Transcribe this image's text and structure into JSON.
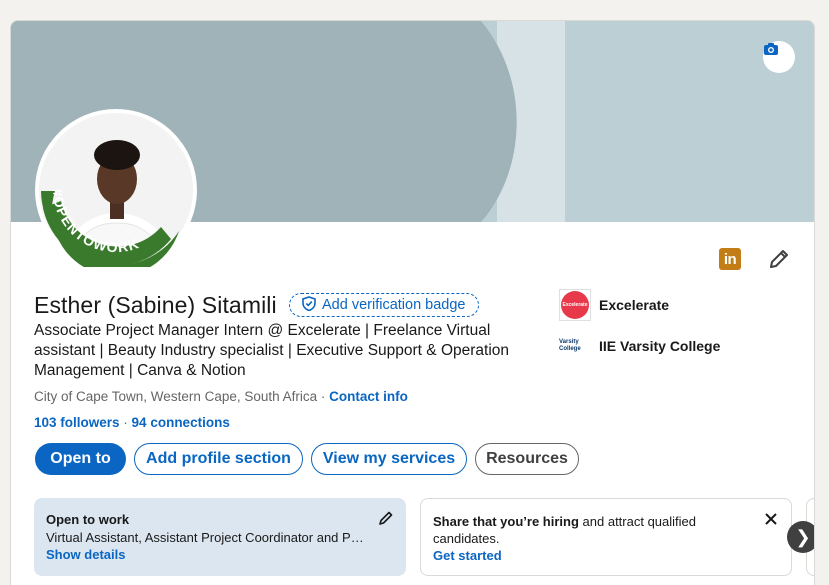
{
  "banner": {
    "camera_icon": "camera-icon",
    "colors": {
      "bg": "#bccfd4",
      "arc": "#9fb3b9",
      "stripe": "#d6e2e5"
    }
  },
  "profile": {
    "name": "Esther (Sabine) Sitamili",
    "verify_label": "Add verification badge",
    "headline": "Associate Project Manager Intern @ Excelerate | Freelance Virtual assistant | Beauty Industry specialist | Executive Support & Operation Management | Canva & Notion",
    "location": "City of Cape Town, Western Cape, South Africa",
    "location_sep": " · ",
    "contact_label": "Contact info",
    "followers": "103 followers",
    "network_sep": " · ",
    "connections": "94 connections",
    "open_to_work_frame": "#OPENTOWORK"
  },
  "orgs": [
    {
      "name": "Excelerate",
      "logo_text": "Excelerate"
    },
    {
      "name": "IIE Varsity College",
      "logo_text_1": "Varsity",
      "logo_text_2": "College"
    }
  ],
  "actions": {
    "open_to": "Open to",
    "add_section": "Add profile section",
    "services": "View my services",
    "resources": "Resources"
  },
  "open_to_work_card": {
    "title": "Open to work",
    "details": "Virtual Assistant, Assistant Project Coordinator and Project Coordinator roles",
    "link": "Show details"
  },
  "hiring_card": {
    "bold": "Share that you’re hiring",
    "rest": " and attract qualified candidates.",
    "link": "Get started"
  },
  "carousel": {
    "next_glyph": "❯"
  },
  "brand": {
    "accent": "#0a66c2",
    "open_to_work_green": "#3a7a2c",
    "linkedin_badge": "#c37d16"
  }
}
